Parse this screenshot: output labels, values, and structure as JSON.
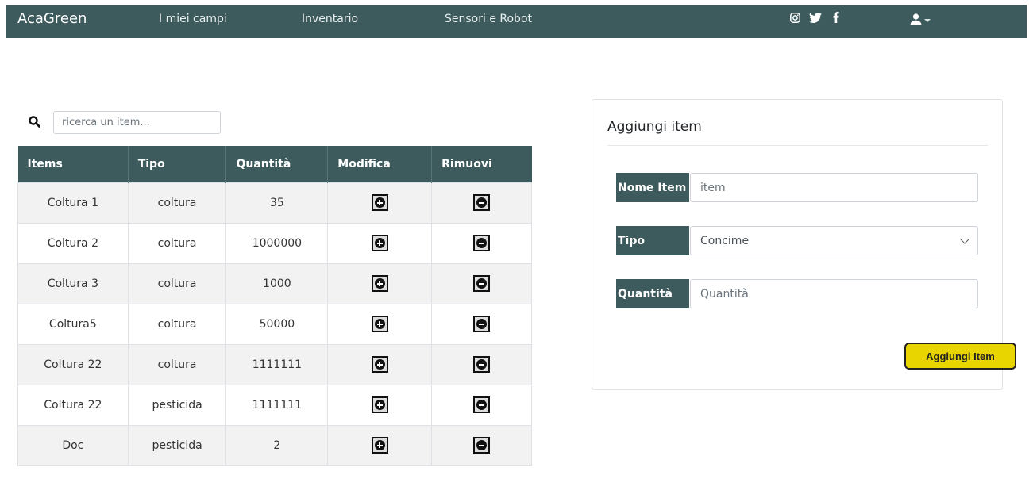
{
  "navbar": {
    "brand": "AcaGreen",
    "links": [
      "I miei campi",
      "Inventario",
      "Sensori e Robot"
    ],
    "social_icons": [
      "instagram-icon",
      "twitter-icon",
      "facebook-icon"
    ],
    "user_icon": "user-icon"
  },
  "search": {
    "placeholder": "ricerca un item..."
  },
  "table": {
    "headers": [
      "Items",
      "Tipo",
      "Quantità",
      "Modifica",
      "Rimuovi"
    ],
    "rows": [
      {
        "item": "Coltura 1",
        "tipo": "coltura",
        "quantita": "35"
      },
      {
        "item": "Coltura 2",
        "tipo": "coltura",
        "quantita": "1000000"
      },
      {
        "item": "Coltura 3",
        "tipo": "coltura",
        "quantita": "1000"
      },
      {
        "item": "Coltura5",
        "tipo": "coltura",
        "quantita": "50000"
      },
      {
        "item": "Coltura 22",
        "tipo": "coltura",
        "quantita": "1111111"
      },
      {
        "item": "Coltura 22",
        "tipo": "pesticida",
        "quantita": "1111111"
      },
      {
        "item": "Doc",
        "tipo": "pesticida",
        "quantita": "2"
      }
    ]
  },
  "form": {
    "title": "Aggiungi item",
    "nome_label": "Nome Item",
    "nome_placeholder": "item",
    "tipo_label": "Tipo",
    "tipo_selected": "Concime",
    "quantita_label": "Quantità",
    "quantita_placeholder": "Quantità",
    "submit_label": "Aggiungi Item"
  },
  "colors": {
    "primary": "#3d5a5c",
    "accent": "#e8d500"
  }
}
